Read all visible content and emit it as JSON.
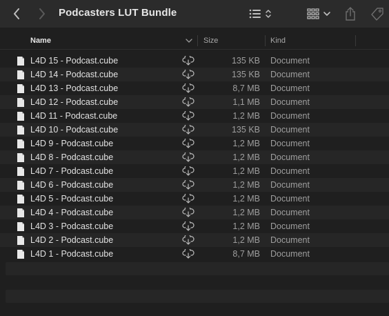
{
  "window": {
    "title": "Podcasters LUT Bundle"
  },
  "toolbar": {
    "back_icon": "chevron-left-icon",
    "forward_icon": "chevron-right-icon",
    "view_icon": "list-view-icon",
    "group_icon": "grid-group-icon",
    "share_icon": "share-icon",
    "tag_icon": "tag-icon"
  },
  "columns": {
    "name": "Name",
    "size": "Size",
    "kind": "Kind"
  },
  "files": [
    {
      "name": "L4D 15 - Podcast.cube",
      "size": "135 KB",
      "kind": "Document"
    },
    {
      "name": "L4D 14 - Podcast.cube",
      "size": "135 KB",
      "kind": "Document"
    },
    {
      "name": "L4D 13 - Podcast.cube",
      "size": "8,7 MB",
      "kind": "Document"
    },
    {
      "name": "L4D 12 - Podcast.cube",
      "size": "1,1 MB",
      "kind": "Document"
    },
    {
      "name": "L4D 11 - Podcast.cube",
      "size": "1,2 MB",
      "kind": "Document"
    },
    {
      "name": "L4D 10 - Podcast.cube",
      "size": "135 KB",
      "kind": "Document"
    },
    {
      "name": "L4D 9 - Podcast.cube",
      "size": "1,2 MB",
      "kind": "Document"
    },
    {
      "name": "L4D 8 - Podcast.cube",
      "size": "1,2 MB",
      "kind": "Document"
    },
    {
      "name": "L4D 7 - Podcast.cube",
      "size": "1,2 MB",
      "kind": "Document"
    },
    {
      "name": "L4D 6 - Podcast.cube",
      "size": "1,2 MB",
      "kind": "Document"
    },
    {
      "name": "L4D 5 - Podcast.cube",
      "size": "1,2 MB",
      "kind": "Document"
    },
    {
      "name": "L4D 4 - Podcast.cube",
      "size": "1,2 MB",
      "kind": "Document"
    },
    {
      "name": "L4D 3 - Podcast.cube",
      "size": "1,2 MB",
      "kind": "Document"
    },
    {
      "name": "L4D 2 - Podcast.cube",
      "size": "1,2 MB",
      "kind": "Document"
    },
    {
      "name": "L4D 1 - Podcast.cube",
      "size": "8,7 MB",
      "kind": "Document"
    }
  ],
  "colors": {
    "background": "#1f1f1f",
    "toolbar": "#2b2b2b",
    "row_alt": "#262626"
  }
}
